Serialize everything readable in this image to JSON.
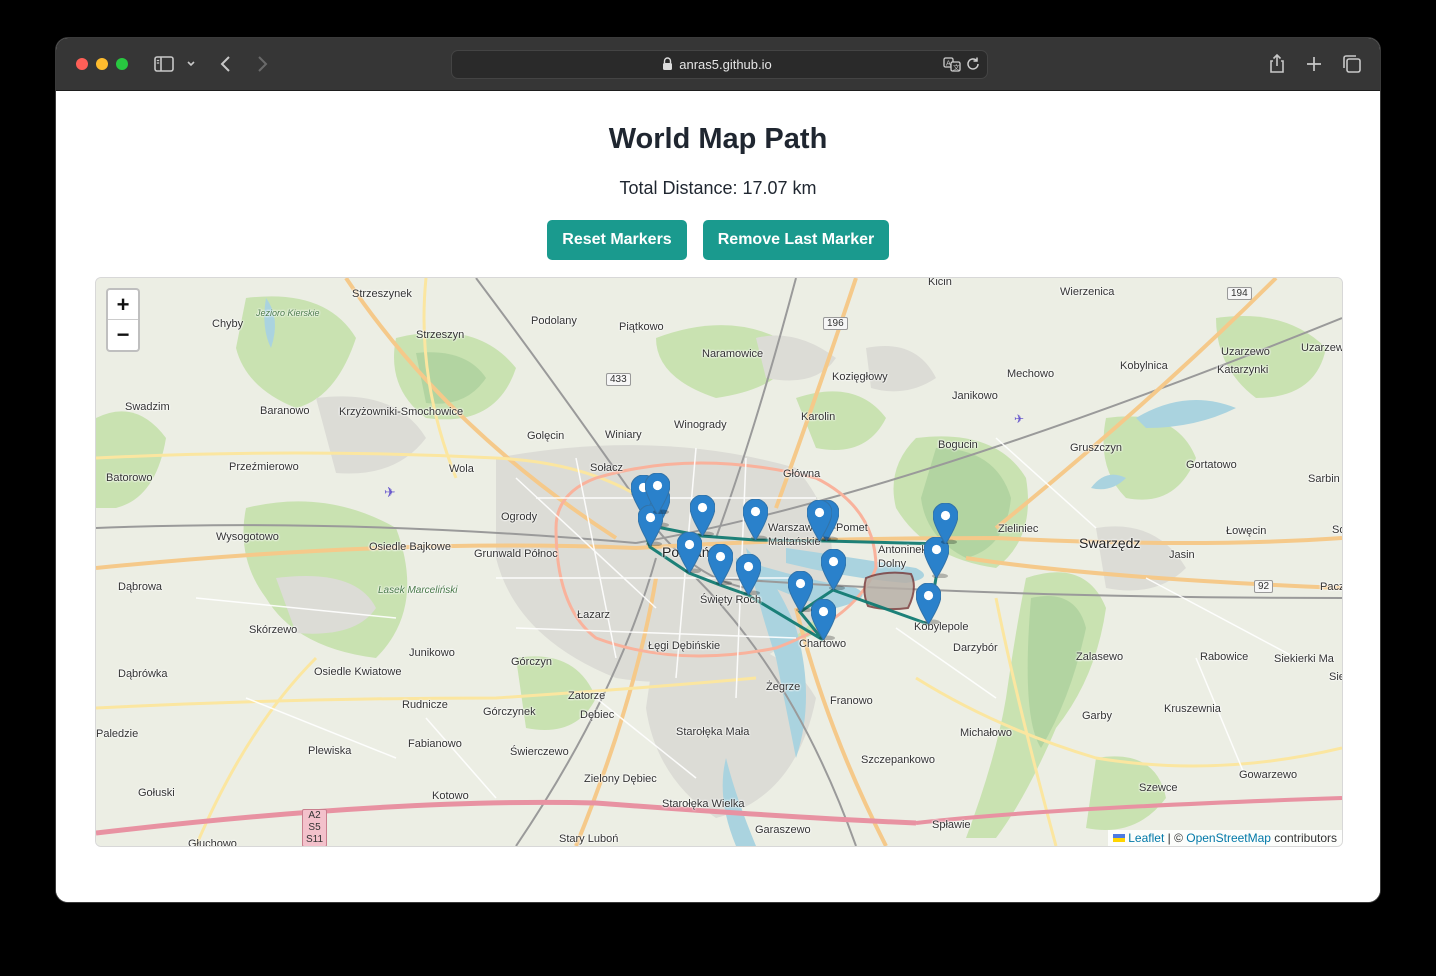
{
  "browser": {
    "url": "anras5.github.io"
  },
  "page": {
    "title": "World Map Path",
    "distance_label": "Total Distance: 17.07 km"
  },
  "buttons": {
    "reset": "Reset Markers",
    "remove_last": "Remove Last Marker"
  },
  "map": {
    "zoom_in": "+",
    "zoom_out": "−",
    "attribution": {
      "leaflet": "Leaflet",
      "separator": " | © ",
      "osm": "OpenStreetMap",
      "suffix": " contributors"
    },
    "markers_count": 17,
    "places": [
      "Strzeszynek",
      "Podolany",
      "Piątkowo",
      "Kicin",
      "Wierzenica",
      "Chyby",
      "Jezioro Kierskie",
      "Strzeszyn",
      "Naramowice",
      "Kozięgłowy",
      "Mechowo",
      "Kobylnica",
      "Uzarzewo",
      "Uzarzewo-H",
      "Katarzynki",
      "Swadzim",
      "Baranowo",
      "Krzyżowniki-Smochowice",
      "Golęcin",
      "Winiary",
      "Winogrady",
      "Karolin",
      "Janikowo",
      "Bogucin",
      "Gruszczyn",
      "Batorowo",
      "Przeźmierowo",
      "Wola",
      "Sołacz",
      "Główna",
      "Gortatowo",
      "Sarbin",
      "Ogrody",
      "Wysogotowo",
      "Osiedle Bajkowe",
      "Grunwald Północ",
      "Poznań",
      "Warszawskie-Pomet Maltańskie",
      "Antoninek-Dolny",
      "Zieliniec",
      "Swarzędz",
      "Jasin",
      "Łowęcin",
      "Dąbrowa",
      "Lasek Marceliński",
      "Święty Roch",
      "Kobylepole",
      "Łazarz",
      "Skórzewo",
      "Junikowo",
      "Łęgi Dębińskie",
      "Chartowo",
      "Darzybór",
      "Zalasewo",
      "Rabowice",
      "Siekierki Ma",
      "Dąbrówka",
      "Osiedle Kwiatowe",
      "Górczyn",
      "Żegrze",
      "Franowo",
      "Zatorze",
      "Rudnicze",
      "Górczynek",
      "Dębiec",
      "Paledzie",
      "Garby",
      "Kruszewnia",
      "Starołęka Mała",
      "Michałowo",
      "Plewiska",
      "Fabianowo",
      "Świerczewo",
      "Szczepankowo",
      "Zielony Dębiec",
      "Gowarzewo",
      "Gołuski",
      "Kotowo",
      "Starołęka Wielka",
      "Szewce",
      "Garaszewo",
      "Spławie",
      "Stary Luboń",
      "Głuchowo",
      "Paczk",
      "Siel",
      "Sol"
    ],
    "road_shields": [
      "194",
      "196",
      "433",
      "92",
      "A2",
      "S5",
      "S11"
    ],
    "colors": {
      "path": "#127a72",
      "marker": "#2a81cb",
      "button": "#1a9a8e"
    }
  }
}
